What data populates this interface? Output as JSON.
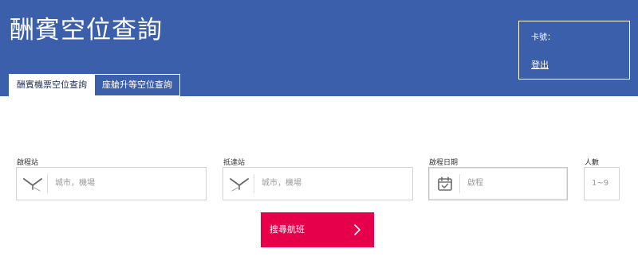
{
  "header": {
    "title": "酬賓空位查詢",
    "tabs": [
      {
        "label": "酬賓機票空位查詢",
        "active": true
      },
      {
        "label": "座艙升等空位查詢",
        "active": false
      }
    ],
    "member": {
      "card_label": "卡號：",
      "logout_label": "登出"
    }
  },
  "search": {
    "origin": {
      "label": "啟程站",
      "placeholder": "城市，機場",
      "icon": "departure-plane-icon"
    },
    "destination": {
      "label": "抵達站",
      "placeholder": "城市，機場",
      "icon": "arrival-plane-icon"
    },
    "date": {
      "label": "啟程日期",
      "placeholder": "啟程",
      "icon": "calendar-check-icon"
    },
    "passengers": {
      "label": "人數",
      "placeholder": "1~9"
    },
    "submit_label": "搜尋航班",
    "submit_icon": "chevron-right-icon"
  },
  "colors": {
    "header_bg": "#3c5fac",
    "button_bg": "#e6004c",
    "text_white": "#ffffff",
    "placeholder": "#9a9a9a"
  }
}
